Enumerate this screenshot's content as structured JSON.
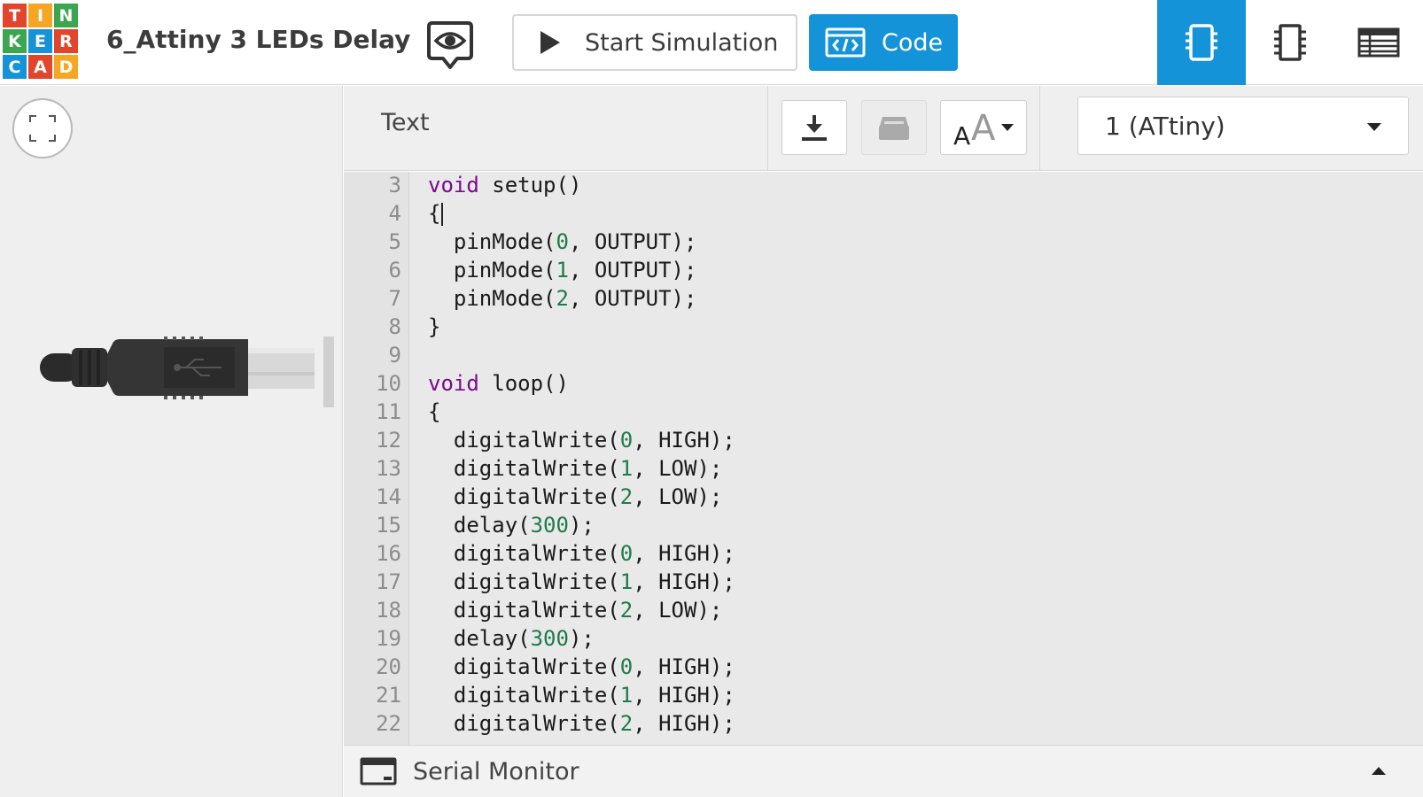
{
  "header": {
    "logo_letters": [
      "T",
      "I",
      "N",
      "K",
      "E",
      "R",
      "C",
      "A",
      "D"
    ],
    "logo_colors": [
      "#e2452b",
      "#f5a623",
      "#3ca54f",
      "#3ca54f",
      "#1593d8",
      "#e2452b",
      "#1593d8",
      "#e2452b",
      "#f5a623"
    ],
    "title": "6_Attiny 3 LEDs Delay",
    "start_simulation_label": "Start Simulation",
    "code_label": "Code",
    "icons": {
      "eye": "eye-icon",
      "play": "play-icon",
      "code": "code-editor-icon",
      "views": [
        "component-icon",
        "chip-icon",
        "table-icon"
      ]
    }
  },
  "code_panel": {
    "mode_label": "Text",
    "device_selected": "1 (ATtiny)",
    "serial_monitor_label": "Serial Monitor",
    "accent": "#1593d8"
  },
  "code": {
    "line_numbers": [
      "3",
      "4",
      "5",
      "6",
      "7",
      "8",
      "9",
      "10",
      "11",
      "12",
      "13",
      "14",
      "15",
      "16",
      "17",
      "18",
      "19",
      "20",
      "21",
      "22"
    ],
    "lines": [
      [
        {
          "t": "void",
          "k": "kw"
        },
        {
          "t": " setup()",
          "k": ""
        }
      ],
      [
        {
          "t": "{",
          "k": ""
        }
      ],
      [
        {
          "t": "  pinMode(",
          "k": ""
        },
        {
          "t": "0",
          "k": "num"
        },
        {
          "t": ", OUTPUT);",
          "k": ""
        }
      ],
      [
        {
          "t": "  pinMode(",
          "k": ""
        },
        {
          "t": "1",
          "k": "num"
        },
        {
          "t": ", OUTPUT);",
          "k": ""
        }
      ],
      [
        {
          "t": "  pinMode(",
          "k": ""
        },
        {
          "t": "2",
          "k": "num"
        },
        {
          "t": ", OUTPUT);",
          "k": ""
        }
      ],
      [
        {
          "t": "}",
          "k": ""
        }
      ],
      [],
      [
        {
          "t": "void",
          "k": "kw"
        },
        {
          "t": " loop()",
          "k": ""
        }
      ],
      [
        {
          "t": "{",
          "k": ""
        }
      ],
      [
        {
          "t": "  digitalWrite(",
          "k": ""
        },
        {
          "t": "0",
          "k": "num"
        },
        {
          "t": ", HIGH);",
          "k": ""
        }
      ],
      [
        {
          "t": "  digitalWrite(",
          "k": ""
        },
        {
          "t": "1",
          "k": "num"
        },
        {
          "t": ", LOW);",
          "k": ""
        }
      ],
      [
        {
          "t": "  digitalWrite(",
          "k": ""
        },
        {
          "t": "2",
          "k": "num"
        },
        {
          "t": ", LOW);",
          "k": ""
        }
      ],
      [
        {
          "t": "  delay(",
          "k": ""
        },
        {
          "t": "300",
          "k": "num"
        },
        {
          "t": ");",
          "k": ""
        }
      ],
      [
        {
          "t": "  digitalWrite(",
          "k": ""
        },
        {
          "t": "0",
          "k": "num"
        },
        {
          "t": ", HIGH);",
          "k": ""
        }
      ],
      [
        {
          "t": "  digitalWrite(",
          "k": ""
        },
        {
          "t": "1",
          "k": "num"
        },
        {
          "t": ", HIGH);",
          "k": ""
        }
      ],
      [
        {
          "t": "  digitalWrite(",
          "k": ""
        },
        {
          "t": "2",
          "k": "num"
        },
        {
          "t": ", LOW);",
          "k": ""
        }
      ],
      [
        {
          "t": "  delay(",
          "k": ""
        },
        {
          "t": "300",
          "k": "num"
        },
        {
          "t": ");",
          "k": ""
        }
      ],
      [
        {
          "t": "  digitalWrite(",
          "k": ""
        },
        {
          "t": "0",
          "k": "num"
        },
        {
          "t": ", HIGH);",
          "k": ""
        }
      ],
      [
        {
          "t": "  digitalWrite(",
          "k": ""
        },
        {
          "t": "1",
          "k": "num"
        },
        {
          "t": ", HIGH);",
          "k": ""
        }
      ],
      [
        {
          "t": "  digitalWrite(",
          "k": ""
        },
        {
          "t": "2",
          "k": "num"
        },
        {
          "t": ", HIGH);",
          "k": ""
        }
      ]
    ],
    "cursor_line": "4"
  }
}
